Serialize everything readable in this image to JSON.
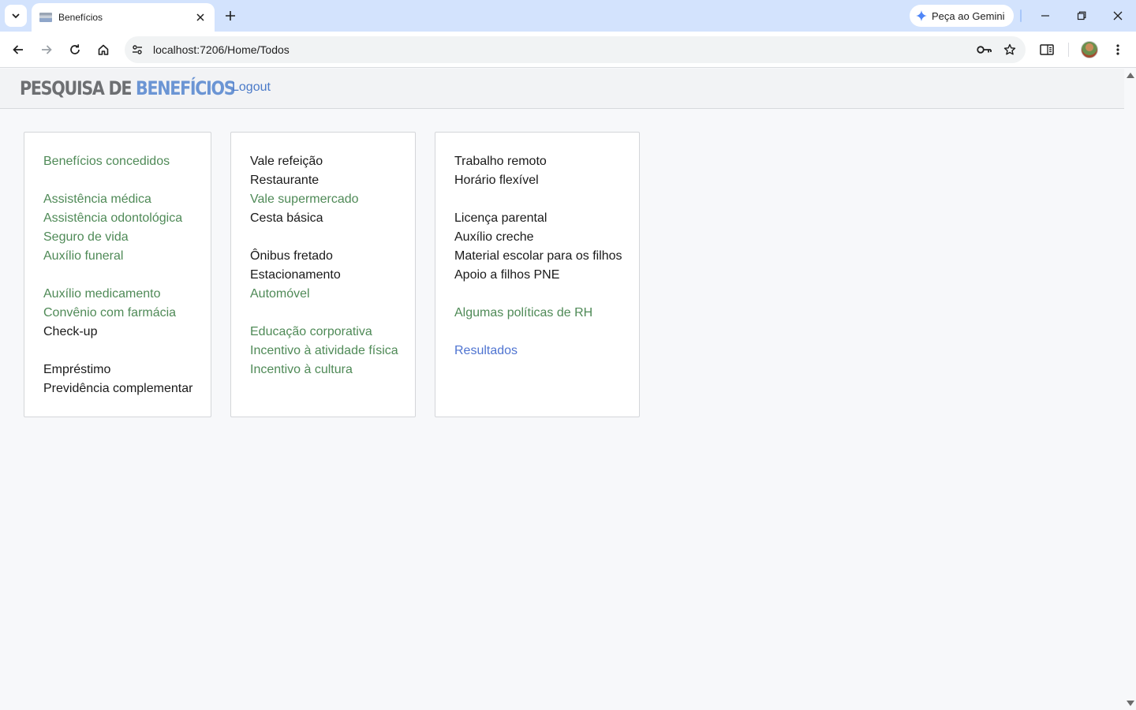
{
  "browser": {
    "tab_title": "Benefícios",
    "url": "localhost:7206/Home/Todos",
    "gemini_label": "Peça ao Gemini"
  },
  "app": {
    "brand_part1": "PESQUISA DE",
    "brand_part2": "BENEFÍCIOS",
    "logout_label": "Logout",
    "brand_colors": {
      "gray": "#6d6f72",
      "blue": "#6b95d4"
    },
    "link_color": "#4f8a57",
    "accent_link_color": "#4f74d1"
  },
  "columns": [
    {
      "groups": [
        [
          {
            "label": "Benefícios concedidos",
            "link": true
          }
        ],
        [
          {
            "label": "Assistência médica",
            "link": true
          },
          {
            "label": "Assistência odontológica",
            "link": true
          },
          {
            "label": "Seguro de vida",
            "link": true
          },
          {
            "label": "Auxílio funeral",
            "link": true
          }
        ],
        [
          {
            "label": "Auxílio medicamento",
            "link": true
          },
          {
            "label": "Convênio com farmácia",
            "link": true
          },
          {
            "label": "Check-up",
            "link": false
          }
        ],
        [
          {
            "label": "Empréstimo",
            "link": false
          },
          {
            "label": "Previdência complementar",
            "link": false
          }
        ]
      ]
    },
    {
      "groups": [
        [
          {
            "label": "Vale refeição",
            "link": false
          },
          {
            "label": "Restaurante",
            "link": false
          },
          {
            "label": "Vale supermercado",
            "link": true
          },
          {
            "label": "Cesta básica",
            "link": false
          }
        ],
        [
          {
            "label": "Ônibus fretado",
            "link": false
          },
          {
            "label": "Estacionamento",
            "link": false
          },
          {
            "label": "Automóvel",
            "link": true
          }
        ],
        [
          {
            "label": "Educação corporativa",
            "link": true
          },
          {
            "label": "Incentivo à atividade física",
            "link": true
          },
          {
            "label": "Incentivo à cultura",
            "link": true
          }
        ]
      ]
    },
    {
      "groups": [
        [
          {
            "label": "Trabalho remoto",
            "link": false
          },
          {
            "label": "Horário flexível",
            "link": false
          }
        ],
        [
          {
            "label": "Licença parental",
            "link": false
          },
          {
            "label": "Auxílio creche",
            "link": false
          },
          {
            "label": "Material escolar para os filhos",
            "link": false
          },
          {
            "label": "Apoio a filhos PNE",
            "link": false
          }
        ],
        [
          {
            "label": "Algumas políticas de RH",
            "link": true
          }
        ],
        [
          {
            "label": "Resultados",
            "link": true,
            "accent": true
          }
        ]
      ]
    }
  ]
}
